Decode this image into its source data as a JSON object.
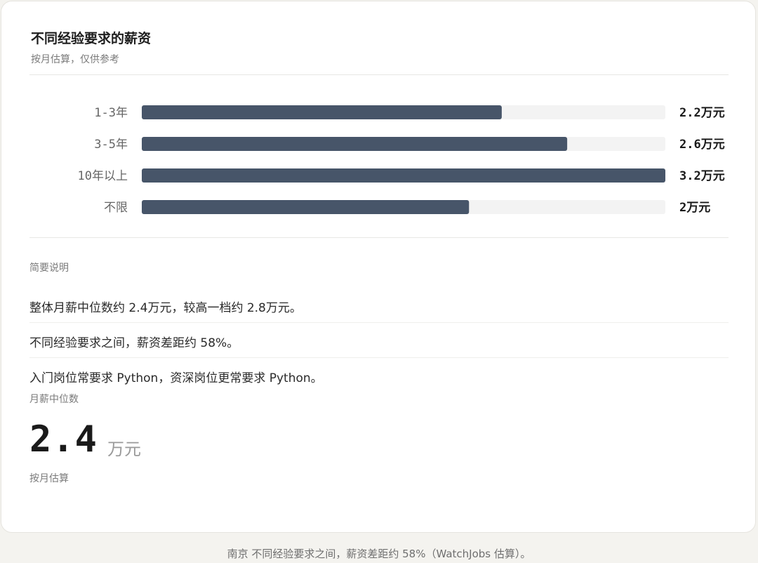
{
  "header": {
    "title": "不同经验要求的薪资",
    "subtitle": "按月估算，仅供参考"
  },
  "chart_data": {
    "type": "bar",
    "orientation": "horizontal",
    "categories": [
      "1-3年",
      "3-5年",
      "10年以上",
      "不限"
    ],
    "values": [
      2.2,
      2.6,
      3.2,
      2
    ],
    "value_labels": [
      "2.2万元",
      "2.6万元",
      "3.2万元",
      "2万元"
    ],
    "unit": "万元",
    "xlim": [
      0,
      3.2
    ],
    "bar_color": "#475569",
    "track_color": "#f3f3f3",
    "grid": false
  },
  "notes": {
    "label": "简要说明",
    "items": [
      "整体月薪中位数约 2.4万元，较高一档约 2.8万元。",
      "不同经验要求之间，薪资差距约 58%。",
      "入门岗位常要求 Python，资深岗位更常要求 Python。"
    ]
  },
  "median": {
    "label": "月薪中位数",
    "value": "2.4",
    "unit": "万元",
    "caption": "按月估算"
  },
  "footer": {
    "text": "南京 不同经验要求之间，薪资差距约 58%（WatchJobs 估算）。"
  }
}
